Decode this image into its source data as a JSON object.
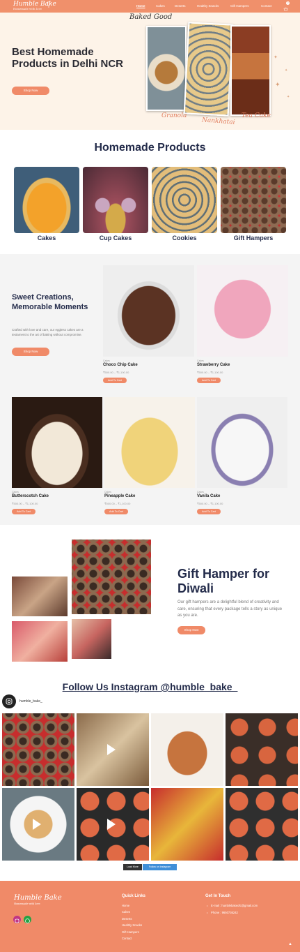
{
  "header": {
    "logo_text": "Humble Bake",
    "logo_tagline": "Homemade with love",
    "nav": [
      "Home",
      "Cakes",
      "Deserts",
      "Healthy Snacks",
      "Gift Hampers",
      "Contact"
    ],
    "cart_count": "0"
  },
  "hero": {
    "title": "Best Homemade Products in Delhi NCR",
    "button": "Shop Now",
    "banner_title": "Baked Good",
    "products": [
      "Granola",
      "Nankhatai",
      "Tea Cake"
    ]
  },
  "products_section": {
    "title": "Homemade Products",
    "categories": [
      "Cakes",
      "Cup Cakes",
      "Cookies",
      "Gift Hampers"
    ]
  },
  "sweet": {
    "title": "Sweet Creations, Memorable Moments",
    "desc": "Crafted with love and care, our eggless cakes are a testament to the art of baking without compromise.",
    "button": "Shop Now",
    "items": [
      {
        "category": "Cakes",
        "name": "Choco Chip Cake",
        "price": "₹500.00 – ₹1,100.00",
        "button": "Add To Cart"
      },
      {
        "category": "Cakes",
        "name": "Strawberry Cake",
        "price": "₹500.00 – ₹1,100.00",
        "button": "Add To Cart"
      },
      {
        "category": "Cakes",
        "name": "Butterscotch Cake",
        "price": "₹500.00 – ₹1,100.00",
        "button": "Add To Cart"
      },
      {
        "category": "Cakes",
        "name": "Pineapple Cake",
        "price": "₹500.00 – ₹1,100.00",
        "button": "Add To Cart"
      },
      {
        "category": "Cakes",
        "name": "Vanila Cake",
        "price": "₹500.00 – ₹1,100.00",
        "button": "Add To Cart"
      }
    ]
  },
  "gift": {
    "title": "Gift Hamper for Diwali",
    "desc": "Our gift hampers are a delightful blend of creativity and care, ensuring that every package tells a story as unique as you are.",
    "button": "Shop Now"
  },
  "instagram": {
    "title": "Follow Us Instagram @humble_bake_",
    "handle": "humble_bake_",
    "load_more": "Load More",
    "follow": "Follow on Instagram"
  },
  "footer": {
    "logo_text": "Humble Bake",
    "logo_tagline": "Homemade with love",
    "quick_links_title": "Quick Links",
    "quick_links": [
      "Home",
      "Cakes",
      "Deserts",
      "Healthy Snacks",
      "Gift Hampers",
      "Contact"
    ],
    "contact_title": "Get In Touch",
    "email": "E-mail : humblebakeofc@gmail.com",
    "phone": "Phone : 9650736242"
  },
  "colors": {
    "accent": "#f08a68",
    "heading": "#232b4a",
    "hero_bg": "#fdf3e8"
  },
  "icons": [
    "whisk-icon",
    "cart-icon",
    "instagram-icon",
    "whatsapp-icon",
    "play-icon",
    "scroll-top-icon"
  ]
}
